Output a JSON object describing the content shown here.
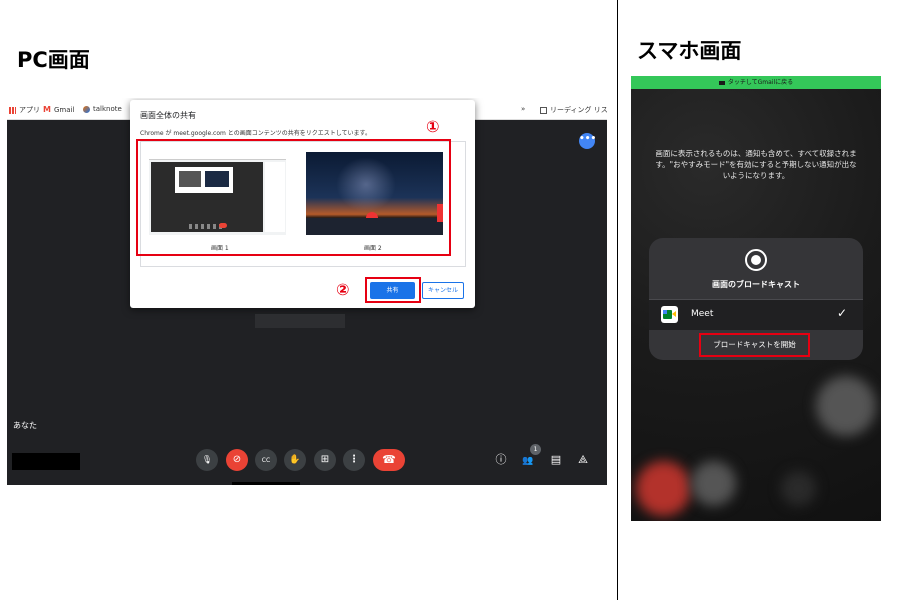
{
  "pc_section": {
    "heading": "PC画面",
    "bookmarks": [
      {
        "label": "アプリ",
        "icon": "apps-grid-icon",
        "color": "#ea4335"
      },
      {
        "label": "Gmail",
        "icon": "gmail-icon",
        "color": "#ea4335"
      },
      {
        "label": "talknote",
        "icon": "talknote-icon",
        "color": "#e8710a"
      }
    ],
    "bookmark_overflow": "»",
    "reading_list": "リーディング リスト",
    "dialog": {
      "title": "画面全体の共有",
      "description": "Chrome が meet.google.com との画面コンテンツの共有をリクエストしています。",
      "screens": [
        {
          "label": "画面 1"
        },
        {
          "label": "画面 2"
        }
      ],
      "share_label": "共有",
      "cancel_label": "キャンセル"
    },
    "annotations": {
      "step1": "①",
      "step2": "②"
    },
    "meet": {
      "self_label": "あなた",
      "participants_count": "1",
      "controls": [
        {
          "name": "mic-button",
          "icon": "microphone-icon",
          "glyph": "🎙",
          "red": false
        },
        {
          "name": "camera-off-button",
          "icon": "camera-off-icon",
          "glyph": "⊘",
          "red": true
        },
        {
          "name": "captions-button",
          "icon": "captions-icon",
          "glyph": "CC",
          "red": false
        },
        {
          "name": "raise-hand-button",
          "icon": "hand-icon",
          "glyph": "✋",
          "red": false
        },
        {
          "name": "present-button",
          "icon": "present-icon",
          "glyph": "⊞",
          "red": false
        },
        {
          "name": "more-options-button",
          "icon": "more-vertical-icon",
          "glyph": "⋮",
          "red": false
        }
      ],
      "end_call_glyph": "☎",
      "right_icons": [
        {
          "name": "info-button",
          "icon": "info-icon",
          "glyph": "ⓘ"
        },
        {
          "name": "people-button",
          "icon": "people-icon",
          "glyph": "👥"
        },
        {
          "name": "chat-button",
          "icon": "chat-icon",
          "glyph": "▤"
        },
        {
          "name": "activities-button",
          "icon": "activities-icon",
          "glyph": "⟁"
        }
      ]
    }
  },
  "phone_section": {
    "heading": "スマホ画面",
    "green_bar": "タッチしてGmailに戻る",
    "info_text": "画面に表示されるものは、通知も含めて、すべて収録されます。\"おやすみモード\"を有効にすると予期しない通知が出ないようになります。",
    "card": {
      "title": "画面のブロードキャスト",
      "app_name": "Meet",
      "checkmark": "✓",
      "start_label": "ブロードキャストを開始"
    }
  },
  "colors": {
    "highlight_red": "#e60012",
    "meet_blue": "#1a73e8",
    "meet_dark": "#202124",
    "green_bar": "#34c759"
  }
}
